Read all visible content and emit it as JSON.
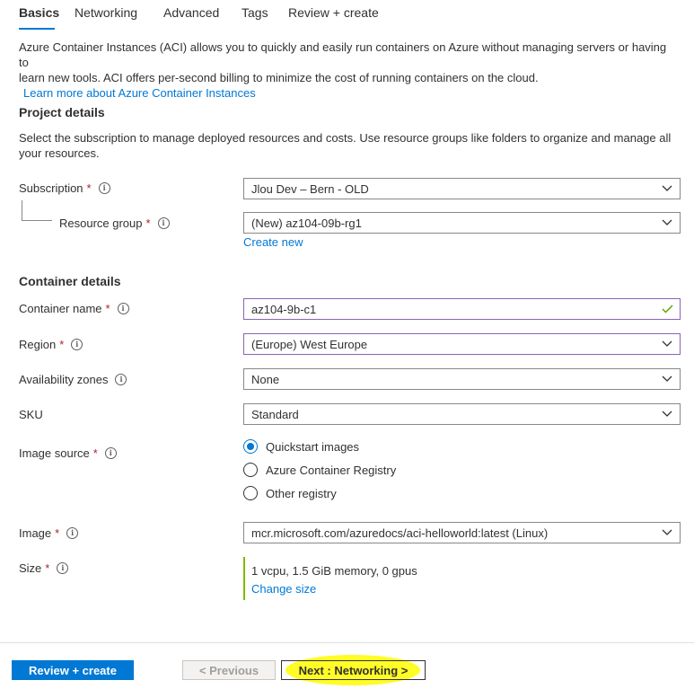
{
  "tabs": [
    {
      "label": "Basics",
      "active": true
    },
    {
      "label": "Networking"
    },
    {
      "label": "Advanced"
    },
    {
      "label": "Tags"
    },
    {
      "label": "Review + create"
    }
  ],
  "intro": {
    "line1": "Azure Container Instances (ACI) allows you to quickly and easily run containers on Azure without managing servers or having to",
    "line2": "learn new tools. ACI offers per-second billing to minimize the cost of running containers on the cloud.",
    "learn_more": "Learn more about Azure Container Instances"
  },
  "project": {
    "title": "Project details",
    "desc_line1": "Select the subscription to manage deployed resources and costs. Use resource groups like folders to organize and manage all",
    "desc_line2": "your resources.",
    "subscription_label": "Subscription",
    "subscription_value": "Jlou Dev – Bern - OLD",
    "resource_group_label": "Resource group",
    "resource_group_value": "(New) az104-09b-rg1",
    "create_new": "Create new"
  },
  "container": {
    "title": "Container details",
    "name_label": "Container name",
    "name_value": "az104-9b-c1",
    "region_label": "Region",
    "region_value": "(Europe) West Europe",
    "zones_label": "Availability zones",
    "zones_value": "None",
    "sku_label": "SKU",
    "sku_value": "Standard",
    "image_source_label": "Image source",
    "image_source_options": [
      "Quickstart images",
      "Azure Container Registry",
      "Other registry"
    ],
    "image_source_selected": 0,
    "image_label": "Image",
    "image_value": "mcr.microsoft.com/azuredocs/aci-helloworld:latest (Linux)",
    "size_label": "Size",
    "size_value": "1 vcpu, 1.5 GiB memory, 0 gpus",
    "change_size": "Change size"
  },
  "common": {
    "required": "*",
    "info": "i"
  },
  "footer": {
    "review_create": "Review + create",
    "previous": "< Previous",
    "next": "Next : Networking >"
  },
  "colors": {
    "accent": "#0078d4",
    "required": "#a4262c",
    "valid_check": "#57a300",
    "size_bar": "#7fba00",
    "highlight": "#fffb00"
  },
  "icons": [
    "chevron-down-icon",
    "checkmark-icon",
    "info-icon"
  ]
}
